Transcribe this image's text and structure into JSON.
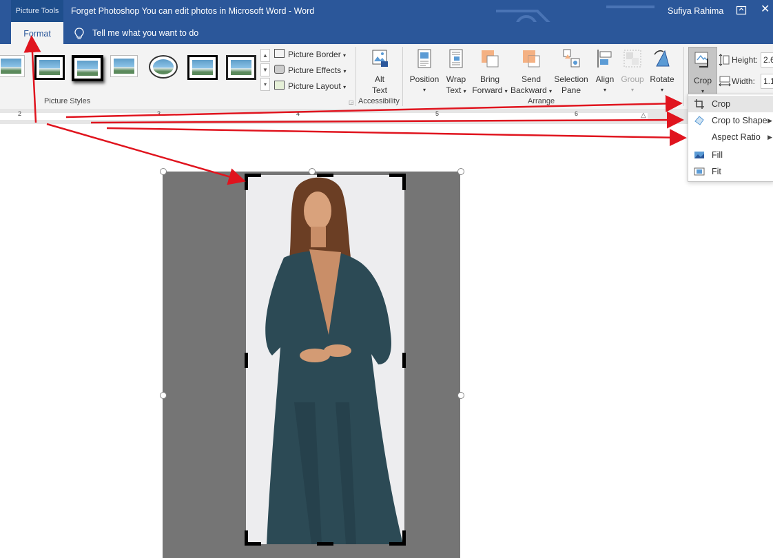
{
  "titlebar": {
    "context_tab": "Picture Tools",
    "document_title": "Forget Photoshop You can edit photos in Microsoft Word  -  Word",
    "user_name": "Sufiya Rahima"
  },
  "tabs": {
    "active": "Format",
    "tell_me": "Tell me what you want to do"
  },
  "ribbon": {
    "picture_styles": {
      "label": "Picture Styles",
      "border": "Picture Border",
      "effects": "Picture Effects",
      "layout": "Picture Layout"
    },
    "accessibility": {
      "label": "Accessibility",
      "alt_text_1": "Alt",
      "alt_text_2": "Text"
    },
    "arrange": {
      "label": "Arrange",
      "position": "Position",
      "wrap_1": "Wrap",
      "wrap_2": "Text",
      "bring_1": "Bring",
      "bring_2": "Forward",
      "send_1": "Send",
      "send_2": "Backward",
      "selection_1": "Selection",
      "selection_2": "Pane",
      "align": "Align",
      "group": "Group",
      "rotate": "Rotate"
    },
    "size": {
      "crop": "Crop",
      "height_label": "Height:",
      "height_value": "2.6",
      "width_label": "Width:",
      "width_value": "1.1"
    }
  },
  "ruler": {
    "numbers": [
      "2",
      "3",
      "4",
      "5",
      "6"
    ]
  },
  "crop_menu": {
    "crop": "Crop",
    "crop_to_shape": "Crop to Shape",
    "aspect_ratio": "Aspect Ratio",
    "fill": "Fill",
    "fit": "Fit"
  },
  "colors": {
    "word_blue": "#2b579a",
    "annotation_red": "#e0141e",
    "crop_dim": "#757575"
  }
}
